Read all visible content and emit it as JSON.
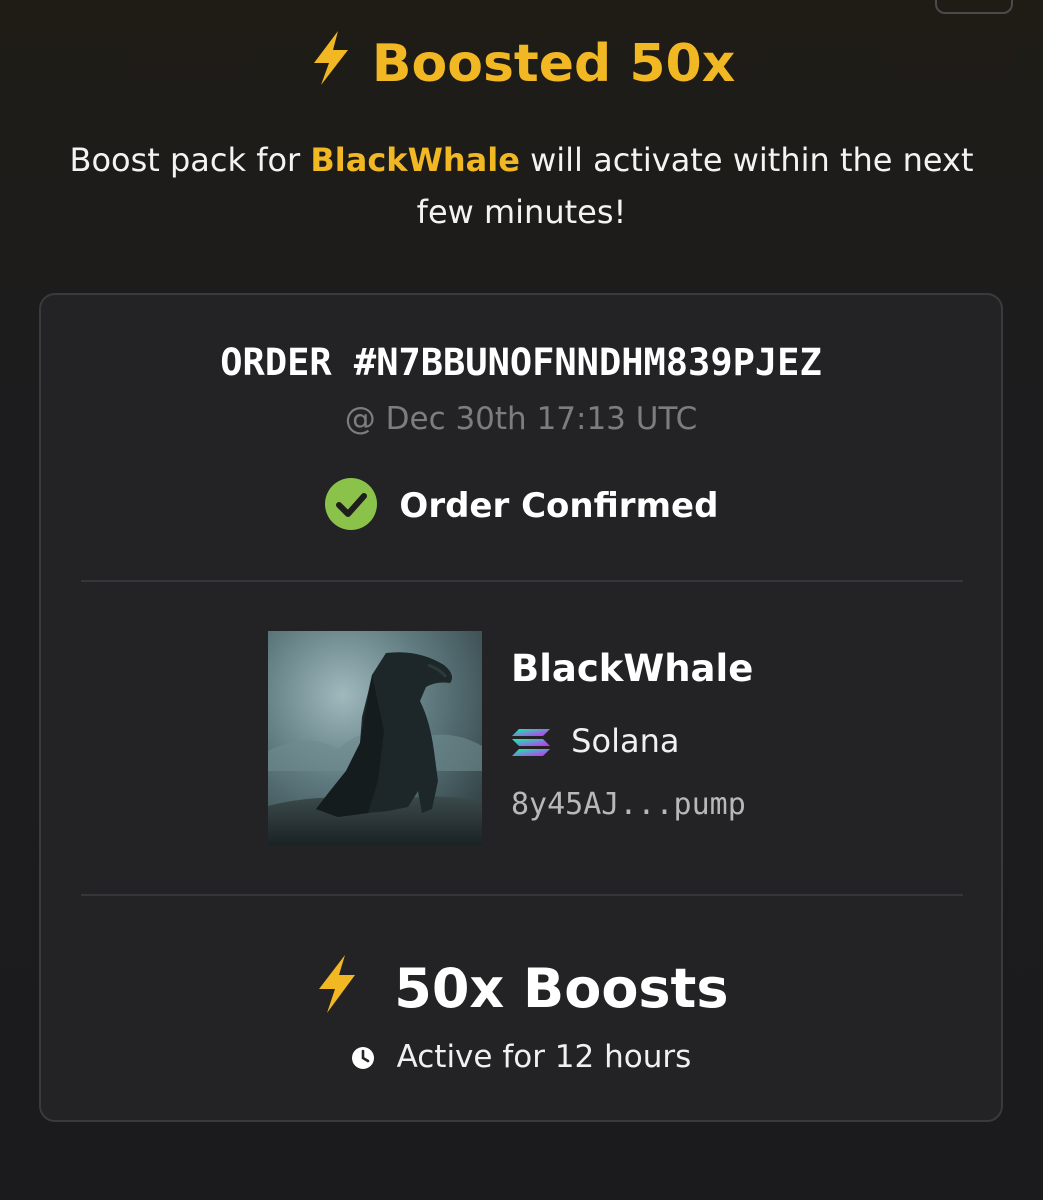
{
  "header": {
    "title": "Boosted 50x",
    "title_icon": "lightning-bolt-icon",
    "accent_color": "#f2b824"
  },
  "message": {
    "prefix": "Boost pack for ",
    "token": "BlackWhale",
    "suffix": " will activate within the next few minutes!"
  },
  "order": {
    "id": "ORDER #N7BBUNOFNNDHM839PJEZ",
    "timestamp": "@ Dec 30th 17:13 UTC",
    "status": "Order Confirmed",
    "status_icon": "check-circle-icon",
    "status_color": "#8bc34a"
  },
  "token": {
    "name": "BlackWhale",
    "chain": "Solana",
    "chain_icon": "solana-icon",
    "address": "8y45AJ...pump",
    "image_icon": "token-artwork-image"
  },
  "boost": {
    "amount": "50x Boosts",
    "amount_icon": "lightning-bolt-icon",
    "duration": "Active for 12 hours",
    "duration_icon": "clock-icon"
  }
}
